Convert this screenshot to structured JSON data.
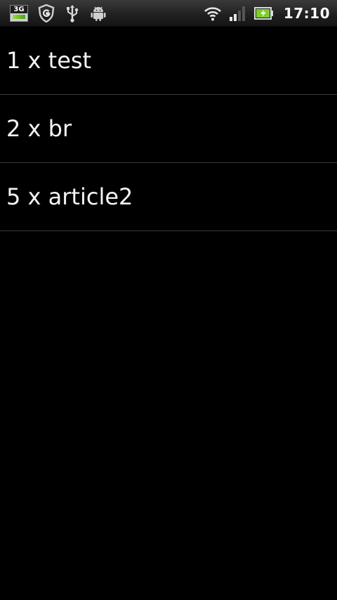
{
  "status_bar": {
    "network_type": "3G",
    "time": "17:10",
    "icons": {
      "left": [
        "3g-notification-icon",
        "shield-g-icon",
        "usb-icon",
        "android-debug-icon"
      ],
      "right": [
        "wifi-icon",
        "signal-strength-icon",
        "battery-charging-icon"
      ]
    },
    "accent_colors": {
      "battery_green": "#7ccd2a",
      "status_icon_gray": "#d9d9d9"
    }
  },
  "list": {
    "items": [
      {
        "label": "1 x test"
      },
      {
        "label": "2 x br"
      },
      {
        "label": "5 x article2"
      }
    ]
  }
}
